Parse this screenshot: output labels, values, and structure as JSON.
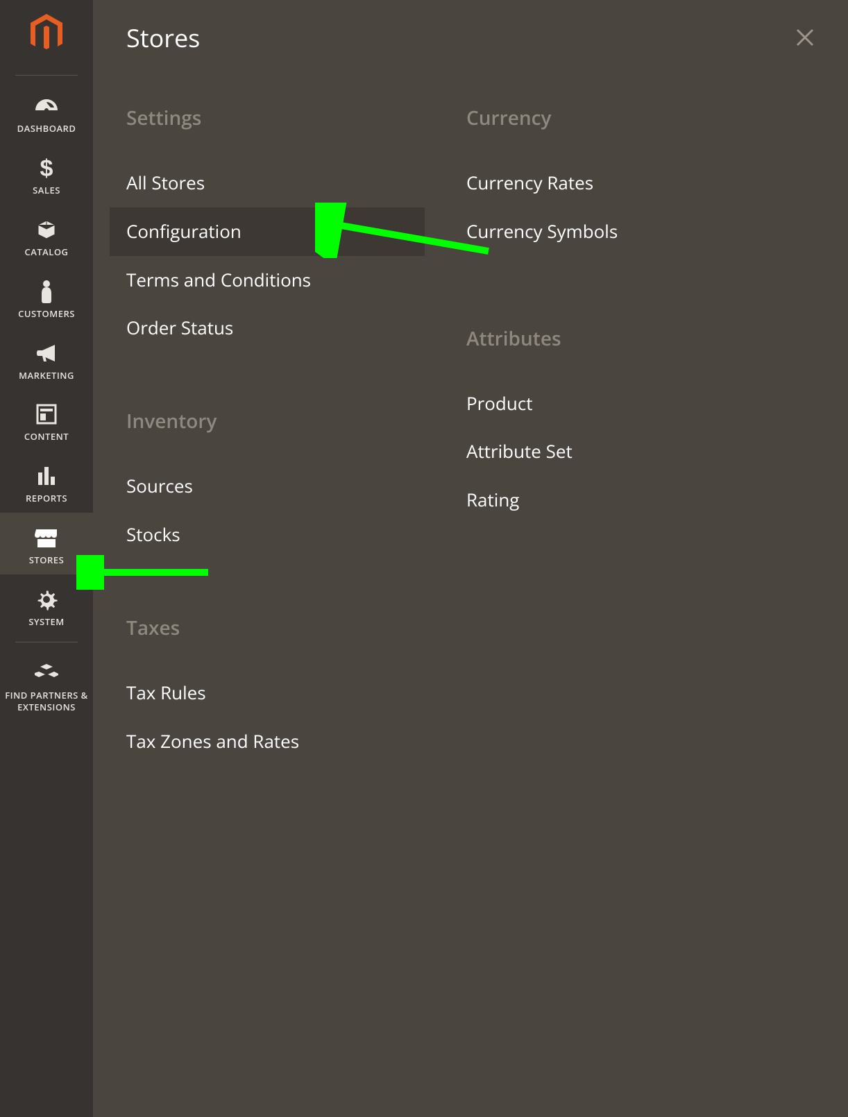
{
  "sidebar": {
    "items": [
      {
        "id": "dashboard",
        "label": "DASHBOARD",
        "icon": "dashboard-icon"
      },
      {
        "id": "sales",
        "label": "SALES",
        "icon": "dollar-icon"
      },
      {
        "id": "catalog",
        "label": "CATALOG",
        "icon": "box-icon"
      },
      {
        "id": "customers",
        "label": "CUSTOMERS",
        "icon": "person-icon"
      },
      {
        "id": "marketing",
        "label": "MARKETING",
        "icon": "megaphone-icon"
      },
      {
        "id": "content",
        "label": "CONTENT",
        "icon": "layout-icon"
      },
      {
        "id": "reports",
        "label": "REPORTS",
        "icon": "chart-icon"
      },
      {
        "id": "stores",
        "label": "STORES",
        "icon": "store-icon",
        "active": true
      },
      {
        "id": "system",
        "label": "SYSTEM",
        "icon": "gear-icon"
      },
      {
        "id": "partners",
        "label": "FIND PARTNERS & EXTENSIONS",
        "icon": "blocks-icon"
      }
    ]
  },
  "panel": {
    "title": "Stores",
    "columns": [
      {
        "sections": [
          {
            "title": "Settings",
            "items": [
              {
                "label": "All Stores"
              },
              {
                "label": "Configuration",
                "highlighted": true
              },
              {
                "label": "Terms and Conditions"
              },
              {
                "label": "Order Status"
              }
            ]
          },
          {
            "title": "Inventory",
            "items": [
              {
                "label": "Sources"
              },
              {
                "label": "Stocks"
              }
            ]
          },
          {
            "title": "Taxes",
            "items": [
              {
                "label": "Tax Rules"
              },
              {
                "label": "Tax Zones and Rates"
              }
            ]
          }
        ]
      },
      {
        "sections": [
          {
            "title": "Currency",
            "items": [
              {
                "label": "Currency Rates"
              },
              {
                "label": "Currency Symbols"
              }
            ]
          },
          {
            "title": "Attributes",
            "items": [
              {
                "label": "Product"
              },
              {
                "label": "Attribute Set"
              },
              {
                "label": "Rating"
              }
            ]
          }
        ]
      }
    ]
  },
  "colors": {
    "accent": "#00ff00",
    "brand": "#e85d22"
  }
}
